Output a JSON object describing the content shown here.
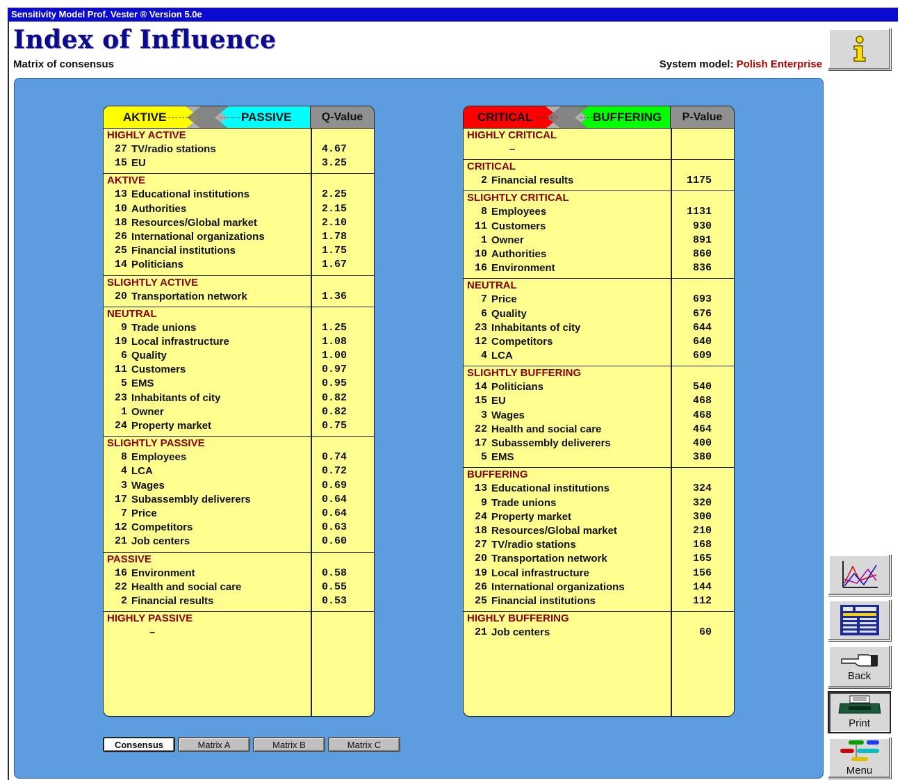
{
  "window": {
    "title": "Sensitivity Model Prof. Vester ® Version 5.0e"
  },
  "header": {
    "title": "Index of Influence",
    "subtitle": "Matrix of consensus",
    "system_model_label": "System model:",
    "system_model_value": "Polish Enterprise"
  },
  "left_table": {
    "header_left": "AKTIVE",
    "header_right": "PASSIVE",
    "value_header": "Q-Value",
    "sections": [
      {
        "title": "HIGHLY ACTIVE",
        "rows": [
          {
            "num": "27",
            "name": "TV/radio stations",
            "value": "4.67"
          },
          {
            "num": "15",
            "name": "EU",
            "value": "3.25"
          }
        ]
      },
      {
        "title": "AKTIVE",
        "rows": [
          {
            "num": "13",
            "name": "Educational institutions",
            "value": "2.25"
          },
          {
            "num": "10",
            "name": "Authorities",
            "value": "2.15"
          },
          {
            "num": "18",
            "name": "Resources/Global market",
            "value": "2.10"
          },
          {
            "num": "26",
            "name": "International organizations",
            "value": "1.78"
          },
          {
            "num": "25",
            "name": "Financial institutions",
            "value": "1.75"
          },
          {
            "num": "14",
            "name": "Politicians",
            "value": "1.67"
          }
        ]
      },
      {
        "title": "SLIGHTLY ACTIVE",
        "rows": [
          {
            "num": "20",
            "name": "Transportation network",
            "value": "1.36"
          }
        ]
      },
      {
        "title": "NEUTRAL",
        "rows": [
          {
            "num": "9",
            "name": "Trade unions",
            "value": "1.25"
          },
          {
            "num": "19",
            "name": "Local infrastructure",
            "value": "1.08"
          },
          {
            "num": "6",
            "name": "Quality",
            "value": "1.00"
          },
          {
            "num": "11",
            "name": "Customers",
            "value": "0.97"
          },
          {
            "num": "5",
            "name": "EMS",
            "value": "0.95"
          },
          {
            "num": "23",
            "name": "Inhabitants of city",
            "value": "0.82"
          },
          {
            "num": "1",
            "name": "Owner",
            "value": "0.82"
          },
          {
            "num": "24",
            "name": "Property market",
            "value": "0.75"
          }
        ]
      },
      {
        "title": "SLIGHTLY PASSIVE",
        "rows": [
          {
            "num": "8",
            "name": "Employees",
            "value": "0.74"
          },
          {
            "num": "4",
            "name": "LCA",
            "value": "0.72"
          },
          {
            "num": "3",
            "name": "Wages",
            "value": "0.69"
          },
          {
            "num": "17",
            "name": "Subassembly deliverers",
            "value": "0.64"
          },
          {
            "num": "7",
            "name": "Price",
            "value": "0.64"
          },
          {
            "num": "12",
            "name": "Competitors",
            "value": "0.63"
          },
          {
            "num": "21",
            "name": "Job centers",
            "value": "0.60"
          }
        ]
      },
      {
        "title": "PASSIVE",
        "rows": [
          {
            "num": "16",
            "name": "Environment",
            "value": "0.58"
          },
          {
            "num": "22",
            "name": "Health and social care",
            "value": "0.55"
          },
          {
            "num": "2",
            "name": "Financial results",
            "value": "0.53"
          }
        ]
      },
      {
        "title": "HIGHLY PASSIVE",
        "rows": [
          {
            "num": "",
            "name": "–",
            "value": ""
          }
        ]
      }
    ]
  },
  "right_table": {
    "header_left": "CRITICAL",
    "header_right": "BUFFERING",
    "value_header": "P-Value",
    "sections": [
      {
        "title": "HIGHLY CRITICAL",
        "rows": [
          {
            "num": "",
            "name": "–",
            "value": ""
          }
        ]
      },
      {
        "title": "CRITICAL",
        "rows": [
          {
            "num": "2",
            "name": "Financial results",
            "value": "1175"
          }
        ]
      },
      {
        "title": "SLIGHTLY CRITICAL",
        "rows": [
          {
            "num": "8",
            "name": "Employees",
            "value": "1131"
          },
          {
            "num": "11",
            "name": "Customers",
            "value": "930"
          },
          {
            "num": "1",
            "name": "Owner",
            "value": "891"
          },
          {
            "num": "10",
            "name": "Authorities",
            "value": "860"
          },
          {
            "num": "16",
            "name": "Environment",
            "value": "836"
          }
        ]
      },
      {
        "title": "NEUTRAL",
        "rows": [
          {
            "num": "7",
            "name": "Price",
            "value": "693"
          },
          {
            "num": "6",
            "name": "Quality",
            "value": "676"
          },
          {
            "num": "23",
            "name": "Inhabitants of city",
            "value": "644"
          },
          {
            "num": "12",
            "name": "Competitors",
            "value": "640"
          },
          {
            "num": "4",
            "name": "LCA",
            "value": "609"
          }
        ]
      },
      {
        "title": "SLIGHTLY BUFFERING",
        "rows": [
          {
            "num": "14",
            "name": "Politicians",
            "value": "540"
          },
          {
            "num": "15",
            "name": "EU",
            "value": "468"
          },
          {
            "num": "3",
            "name": "Wages",
            "value": "468"
          },
          {
            "num": "22",
            "name": "Health and social care",
            "value": "464"
          },
          {
            "num": "17",
            "name": "Subassembly deliverers",
            "value": "400"
          },
          {
            "num": "5",
            "name": "EMS",
            "value": "380"
          }
        ]
      },
      {
        "title": "BUFFERING",
        "rows": [
          {
            "num": "13",
            "name": "Educational institutions",
            "value": "324"
          },
          {
            "num": "9",
            "name": "Trade unions",
            "value": "320"
          },
          {
            "num": "24",
            "name": "Property market",
            "value": "300"
          },
          {
            "num": "18",
            "name": "Resources/Global market",
            "value": "210"
          },
          {
            "num": "27",
            "name": "TV/radio stations",
            "value": "168"
          },
          {
            "num": "20",
            "name": "Transportation network",
            "value": "165"
          },
          {
            "num": "19",
            "name": "Local infrastructure",
            "value": "156"
          },
          {
            "num": "26",
            "name": "International organizations",
            "value": "144"
          },
          {
            "num": "25",
            "name": "Financial institutions",
            "value": "112"
          }
        ]
      },
      {
        "title": "HIGHLY BUFFERING",
        "rows": [
          {
            "num": "21",
            "name": "Job centers",
            "value": "60"
          }
        ]
      }
    ]
  },
  "tabs": [
    {
      "label": "Consensus",
      "active": true
    },
    {
      "label": "Matrix A",
      "active": false
    },
    {
      "label": "Matrix B",
      "active": false
    },
    {
      "label": "Matrix C",
      "active": false
    }
  ],
  "sidebar": {
    "info_icon": "info-icon",
    "chart_icon": "chart-icon",
    "table_icon": "variables-table-icon",
    "back_label": "Back",
    "print_label": "Print",
    "menu_label": "Menu"
  },
  "colors": {
    "titlebar": "#0a0ad0",
    "panel": "#5b9dde",
    "table_bg": "#ffff90",
    "section_title": "#8a0000",
    "aktive": "#ffff00",
    "passive": "#00ffff",
    "critical": "#ff0000",
    "buffering": "#00ff00"
  }
}
